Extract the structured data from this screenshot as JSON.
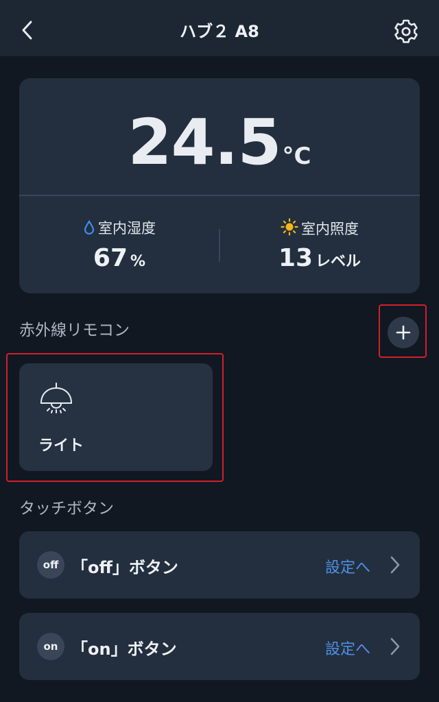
{
  "header": {
    "title": "ハブ２ A8",
    "back_icon": "chevron-left-icon",
    "settings_icon": "gear-icon"
  },
  "sensors": {
    "temperature": {
      "value": "24.5",
      "unit": "°C"
    },
    "humidity": {
      "label": "室内湿度",
      "value": "67",
      "unit": "%",
      "icon": "water-drop-icon",
      "icon_color": "#3e8ef0"
    },
    "illuminance": {
      "label": "室内照度",
      "value": "13",
      "unit": "レベル",
      "icon": "sun-icon",
      "icon_color": "#f6b519"
    }
  },
  "ir_remote": {
    "section_title": "赤外線リモコン",
    "add_icon": "plus-icon",
    "devices": [
      {
        "label": "ライト",
        "icon": "ceiling-lamp-icon"
      }
    ]
  },
  "touch_buttons": {
    "section_title": "タッチボタン",
    "items": [
      {
        "badge": "off",
        "label": "「off」ボタン",
        "action": "設定へ"
      },
      {
        "badge": "on",
        "label": "「on」ボタン",
        "action": "設定へ"
      }
    ]
  },
  "colors": {
    "background": "#111822",
    "card": "#232f3e",
    "accent_link": "#4f8fe6",
    "highlight": "#d31f2a"
  }
}
